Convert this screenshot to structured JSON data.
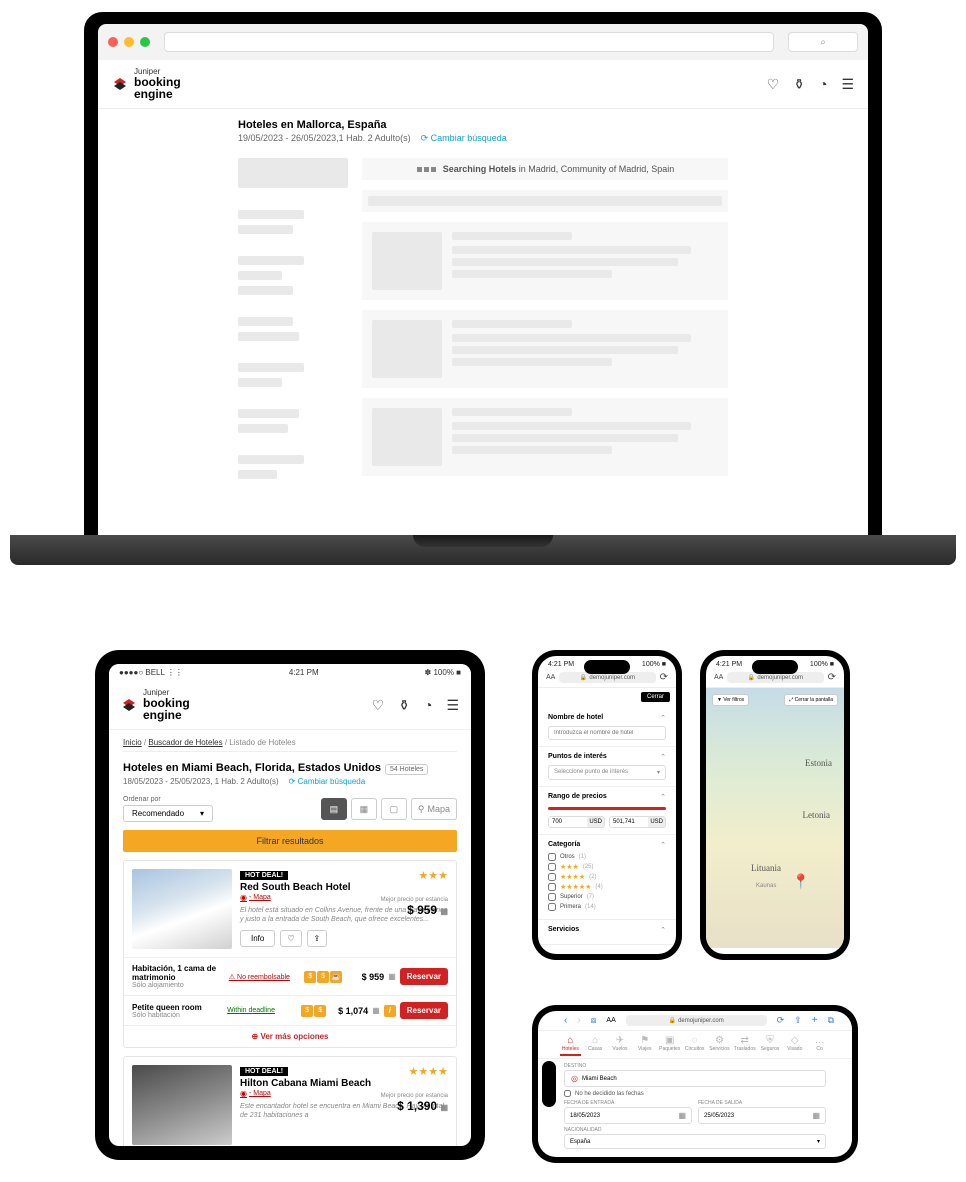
{
  "logo": {
    "brand": "Juniper",
    "line1": "booking",
    "line2": "engine"
  },
  "laptop": {
    "title": "Hoteles en Mallorca, España",
    "subtitle": "19/05/2023 - 26/05/2023,1 Hab. 2 Adulto(s)",
    "change_search": "⟳ Cambiar búsqueda",
    "loading_prefix": "Searching Hotels",
    "loading_in": " in ",
    "loading_location": "Madrid, Community of Madrid, Spain"
  },
  "tablet": {
    "status": {
      "carrier": "●●●●○ BELL",
      "wifi": "⋮⋮",
      "time": "4:21 PM",
      "bluetooth": "✽",
      "battery": "100% ■"
    },
    "crumbs": [
      "Inicio",
      "Buscador de Hoteles",
      "Listado de Hoteles"
    ],
    "title": "Hoteles en Miami Beach, Florida, Estados Unidos",
    "count": "54 Hoteles",
    "subtitle": "18/05/2023 - 25/05/2023,  1 Hab. 2 Adulto(s)",
    "change_search": "⟳ Cambiar búsqueda",
    "sort_label": "Ordenar por",
    "sort_value": "Recomendado",
    "map_btn": "Mapa",
    "filter_bar": "Filtrar resultados",
    "hotels": [
      {
        "badge": "HOT DEAL!",
        "name": "Red South Beach Hotel",
        "map": "- Mapa",
        "stars": "★★★",
        "price_label": "Mejor precio por estancia",
        "price": "$ 959",
        "cal": "▦",
        "desc": "El hotel está situado en Collins Avenue, frente de una playa blanca y justo a la entrada de South Beach, que ofrece excelentes...",
        "info": "Info",
        "rooms": [
          {
            "name": "Habitación, 1 cama de matrimonio",
            "detail": "Sólo alojamiento",
            "policy": "⚠ No reembolsable",
            "pol_class": "nr",
            "icons": [
              "$",
              "$",
              "☕"
            ],
            "price": "$ 959",
            "info": false,
            "btn": "Reservar"
          },
          {
            "name": "Petite queen room",
            "detail": "Sólo habitación",
            "policy": "Within deadline",
            "pol_class": "wd",
            "icons": [
              "$",
              "$"
            ],
            "price": "$ 1,074",
            "info": true,
            "btn": "Reservar"
          }
        ],
        "more": "Ver más opciones"
      },
      {
        "badge": "HOT DEAL!",
        "name": "Hilton Cabana Miami Beach",
        "map": "- Mapa",
        "stars": "★★★★",
        "price_label": "Mejor precio por estancia",
        "price": "$ 1,390",
        "cal": "▦",
        "desc": "Este encantador hotel se encuentra en Miami Beach. Hay un total de 231 habitaciones a"
      }
    ]
  },
  "phone1": {
    "status": {
      "time": "4:21 PM",
      "battery": "100% ■"
    },
    "url": "demojuniper.com",
    "close": "Cerrar",
    "s1": {
      "title": "Nombre de hotel",
      "placeholder": "Introduzca el nombre de hotel"
    },
    "s2": {
      "title": "Puntos de interés",
      "placeholder": "Seleccione punto de interés"
    },
    "s3": {
      "title": "Rango de precios",
      "from": "700",
      "to": "501,741",
      "cur": "USD"
    },
    "s4": {
      "title": "Categoría",
      "rows": [
        {
          "label": "Otros",
          "count": "(1)",
          "stars": ""
        },
        {
          "label": "",
          "count": "(25)",
          "stars": "★★★"
        },
        {
          "label": "",
          "count": "(2)",
          "stars": "★★★★"
        },
        {
          "label": "",
          "count": "(4)",
          "stars": "★★★★★"
        },
        {
          "label": "Superior",
          "count": "(7)",
          "stars": ""
        },
        {
          "label": "Primera",
          "count": "(14)",
          "stars": ""
        }
      ]
    },
    "s5": "Servicios"
  },
  "phone2": {
    "status": {
      "time": "4:21 PM",
      "battery": "100% ■"
    },
    "url": "demojuniper.com",
    "chip1": "▼ Ver filtros",
    "chip2": "⤢ Cerrar la pantalla",
    "labels": {
      "estonia": "Estonia",
      "letonia": "Letonia",
      "lituania": "Lituania",
      "kaunas": "Kaunas"
    }
  },
  "phone3": {
    "url": "demojuniper.com",
    "aa": "AA",
    "tabs": [
      "Hoteles",
      "Casas",
      "Vuelos",
      "Viajes",
      "Paquetes",
      "Circuitos",
      "Servicios",
      "Traslados",
      "Seguros",
      "Visado",
      "Co"
    ],
    "dest_label": "DESTINO",
    "dest": "Miami Beach",
    "chk": "No he decidido las fechas",
    "date_in_label": "FECHA DE ENTRADA",
    "date_in": "18/05/2023",
    "date_out_label": "FECHA DE SALIDA",
    "date_out": "25/05/2023",
    "nat_label": "NACIONALIDAD",
    "nat": "España"
  }
}
